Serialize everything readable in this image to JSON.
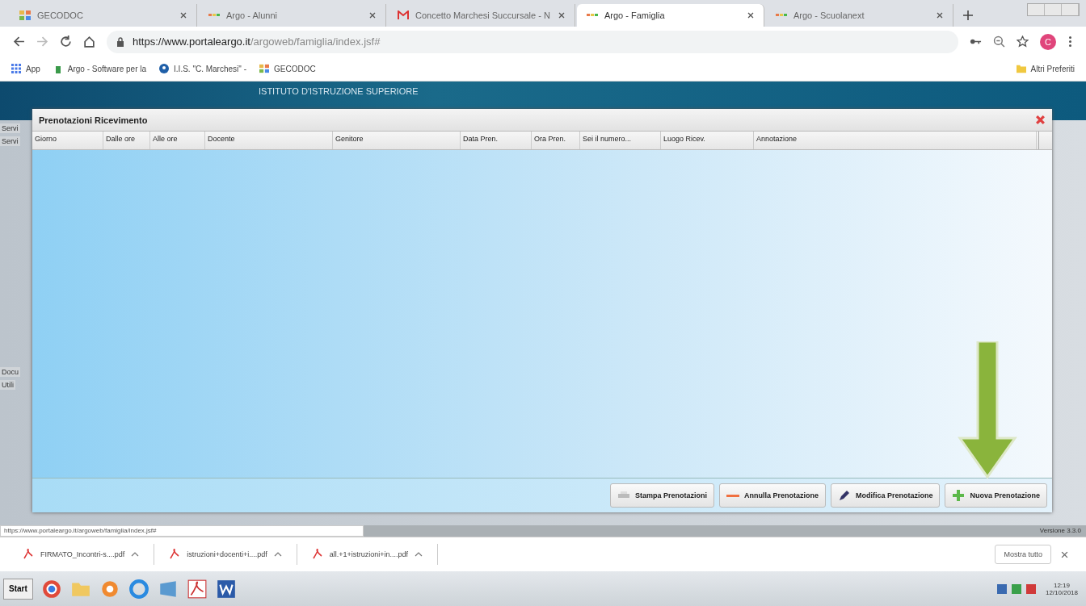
{
  "browser": {
    "tabs": [
      {
        "label": "GECODOC",
        "selected": false
      },
      {
        "label": "Argo - Alunni",
        "selected": false
      },
      {
        "label": "Concetto Marchesi Succursale - N",
        "selected": false
      },
      {
        "label": "Argo - Famiglia",
        "selected": true
      },
      {
        "label": "Argo - Scuolanext",
        "selected": false
      }
    ],
    "url_host": "https://www.portaleargo.it",
    "url_path": "/argoweb/famiglia/index.jsf#",
    "profile_initial": "C",
    "bookmarks": [
      "App",
      "Argo - Software per la",
      "I.I.S. \"C. Marchesi\" -",
      "GECODOC"
    ],
    "other_bookmarks": "Altri Preferiti"
  },
  "page": {
    "header_title": "ISTITUTO D'ISTRUZIONE SUPERIORE",
    "sidebar_labels": [
      "Servi",
      "Servi",
      "Docu",
      "Utili"
    ],
    "version": "Versione 3.3.0"
  },
  "dialog": {
    "title": "Prenotazioni Ricevimento",
    "columns": [
      "Giorno",
      "Dalle ore",
      "Alle ore",
      "Docente",
      "Genitore",
      "Data Pren.",
      "Ora Pren.",
      "Sei il numero...",
      "Luogo Ricev.",
      "Annotazione"
    ],
    "buttons": [
      {
        "label": "Stampa Prenotazioni",
        "kind": "print"
      },
      {
        "label": "Annulla Prenotazione",
        "kind": "cancel"
      },
      {
        "label": "Modifica Prenotazione",
        "kind": "edit"
      },
      {
        "label": "Nuova Prenotazione",
        "kind": "new"
      }
    ]
  },
  "status_url": "https://www.portaleargo.it/argoweb/famiglia/index.jsf#",
  "downloads": {
    "items": [
      "FIRMATO_Incontri-s....pdf",
      "istruzioni+docenti+i....pdf",
      "all.+1+istruzioni+in....pdf"
    ],
    "show_all": "Mostra tutto"
  },
  "taskbar": {
    "start": "Start",
    "time": "12:19",
    "date": "12/10/2018"
  }
}
